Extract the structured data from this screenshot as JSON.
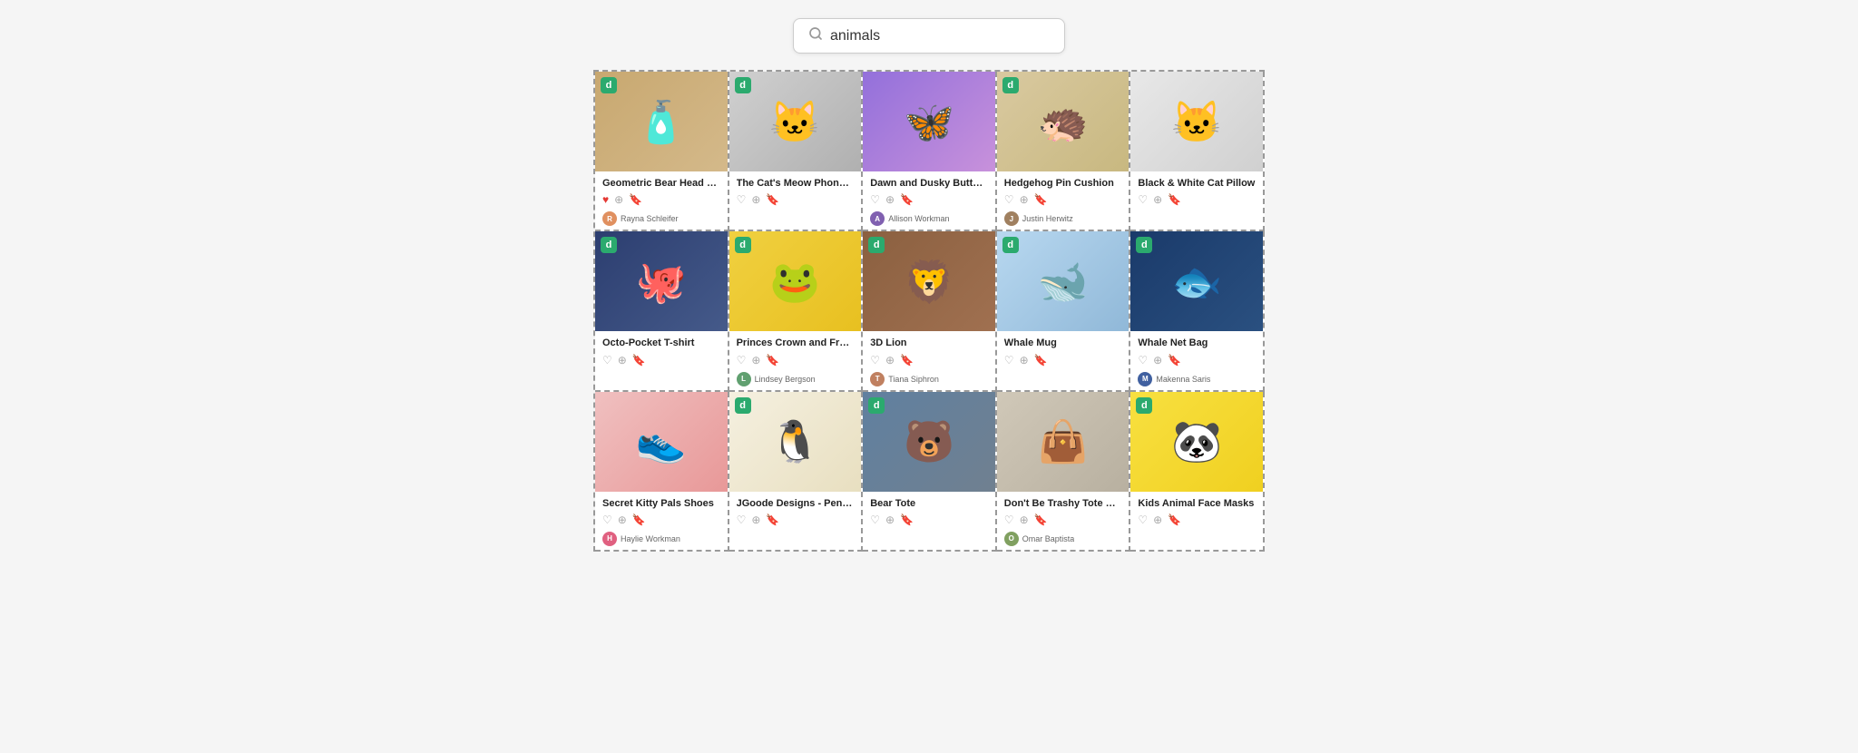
{
  "search": {
    "placeholder": "animals",
    "value": "animals"
  },
  "cards": [
    {
      "id": "card-1",
      "title": "Geometric Bear Head W...",
      "badge": true,
      "badgeType": "green",
      "badgeLabel": "d",
      "liked": true,
      "imageEmoji": "🧴",
      "imageClass": "img-tan",
      "author": "Rayna Schleifer",
      "authorInitial": "R",
      "authorColor": "#e09060"
    },
    {
      "id": "card-2",
      "title": "The Cat's Meow Phone Hol...",
      "badge": true,
      "badgeType": "green",
      "badgeLabel": "d",
      "liked": false,
      "imageEmoji": "🐱",
      "imageClass": "img-gray",
      "author": "",
      "authorInitial": "",
      "authorColor": "#aaa"
    },
    {
      "id": "card-3",
      "title": "Dawn and Dusky Butterfly...",
      "badge": false,
      "liked": false,
      "imageEmoji": "🦋",
      "imageClass": "img-purple",
      "author": "Allison Workman",
      "authorInitial": "A",
      "authorColor": "#8060b0"
    },
    {
      "id": "card-4",
      "title": "Hedgehog Pin Cushion",
      "badge": true,
      "badgeType": "green",
      "badgeLabel": "d",
      "liked": false,
      "imageEmoji": "🦔",
      "imageClass": "img-beige",
      "author": "Justin Herwitz",
      "authorInitial": "J",
      "authorColor": "#a08060"
    },
    {
      "id": "card-5",
      "title": "Black & White Cat Pillow",
      "badge": false,
      "liked": false,
      "imageEmoji": "🐱",
      "imageClass": "img-lightgray",
      "author": "",
      "authorInitial": "",
      "authorColor": "#aaa"
    },
    {
      "id": "card-6",
      "title": "Octo-Pocket T-shirt",
      "badge": true,
      "badgeType": "green",
      "badgeLabel": "d",
      "liked": false,
      "imageEmoji": "🐙",
      "imageClass": "img-navy",
      "author": "",
      "authorInitial": "",
      "authorColor": "#aaa"
    },
    {
      "id": "card-7",
      "title": "Princes Crown and Frog To...",
      "badge": true,
      "badgeType": "green",
      "badgeLabel": "d",
      "liked": false,
      "imageEmoji": "🐸",
      "imageClass": "img-yellow",
      "author": "Lindsey Bergson",
      "authorInitial": "L",
      "authorColor": "#60a070"
    },
    {
      "id": "card-8",
      "title": "3D Lion",
      "badge": true,
      "badgeType": "green",
      "badgeLabel": "d",
      "liked": false,
      "imageEmoji": "🦁",
      "imageClass": "img-brown",
      "author": "Tiana Siphron",
      "authorInitial": "T",
      "authorColor": "#c08060"
    },
    {
      "id": "card-9",
      "title": "Whale Mug",
      "badge": true,
      "badgeType": "green",
      "badgeLabel": "d",
      "liked": false,
      "imageEmoji": "🐋",
      "imageClass": "img-lightblue",
      "author": "",
      "authorInitial": "",
      "authorColor": "#aaa"
    },
    {
      "id": "card-10",
      "title": "Whale Net Bag",
      "badge": true,
      "badgeType": "green",
      "badgeLabel": "d",
      "liked": false,
      "imageEmoji": "🐟",
      "imageClass": "img-darkblue",
      "author": "Makenna Saris",
      "authorInitial": "M",
      "authorColor": "#4060a0"
    },
    {
      "id": "card-11",
      "title": "Secret Kitty Pals Shoes",
      "badge": false,
      "liked": false,
      "imageEmoji": "👟",
      "imageClass": "img-pink",
      "author": "Haylie Workman",
      "authorInitial": "H",
      "authorColor": "#e06080"
    },
    {
      "id": "card-12",
      "title": "JGoode Designs - Penguin...",
      "badge": true,
      "badgeType": "green",
      "badgeLabel": "d",
      "liked": false,
      "imageEmoji": "🐧",
      "imageClass": "img-cream",
      "author": "",
      "authorInitial": "",
      "authorColor": "#aaa"
    },
    {
      "id": "card-13",
      "title": "Bear Tote",
      "badge": true,
      "badgeType": "green",
      "badgeLabel": "d",
      "liked": false,
      "imageEmoji": "🐻",
      "imageClass": "img-slate",
      "author": "",
      "authorInitial": "",
      "authorColor": "#aaa"
    },
    {
      "id": "card-14",
      "title": "Don't Be Trashy Tote Bag",
      "badge": false,
      "liked": false,
      "imageEmoji": "👜",
      "imageClass": "img-tote",
      "author": "Omar Baptista",
      "authorInitial": "O",
      "authorColor": "#80a060"
    },
    {
      "id": "card-15",
      "title": "Kids Animal Face Masks",
      "badge": true,
      "badgeType": "green",
      "badgeLabel": "d",
      "liked": false,
      "imageEmoji": "🐼",
      "imageClass": "img-brightyellow",
      "author": "",
      "authorInitial": "",
      "authorColor": "#aaa"
    }
  ]
}
